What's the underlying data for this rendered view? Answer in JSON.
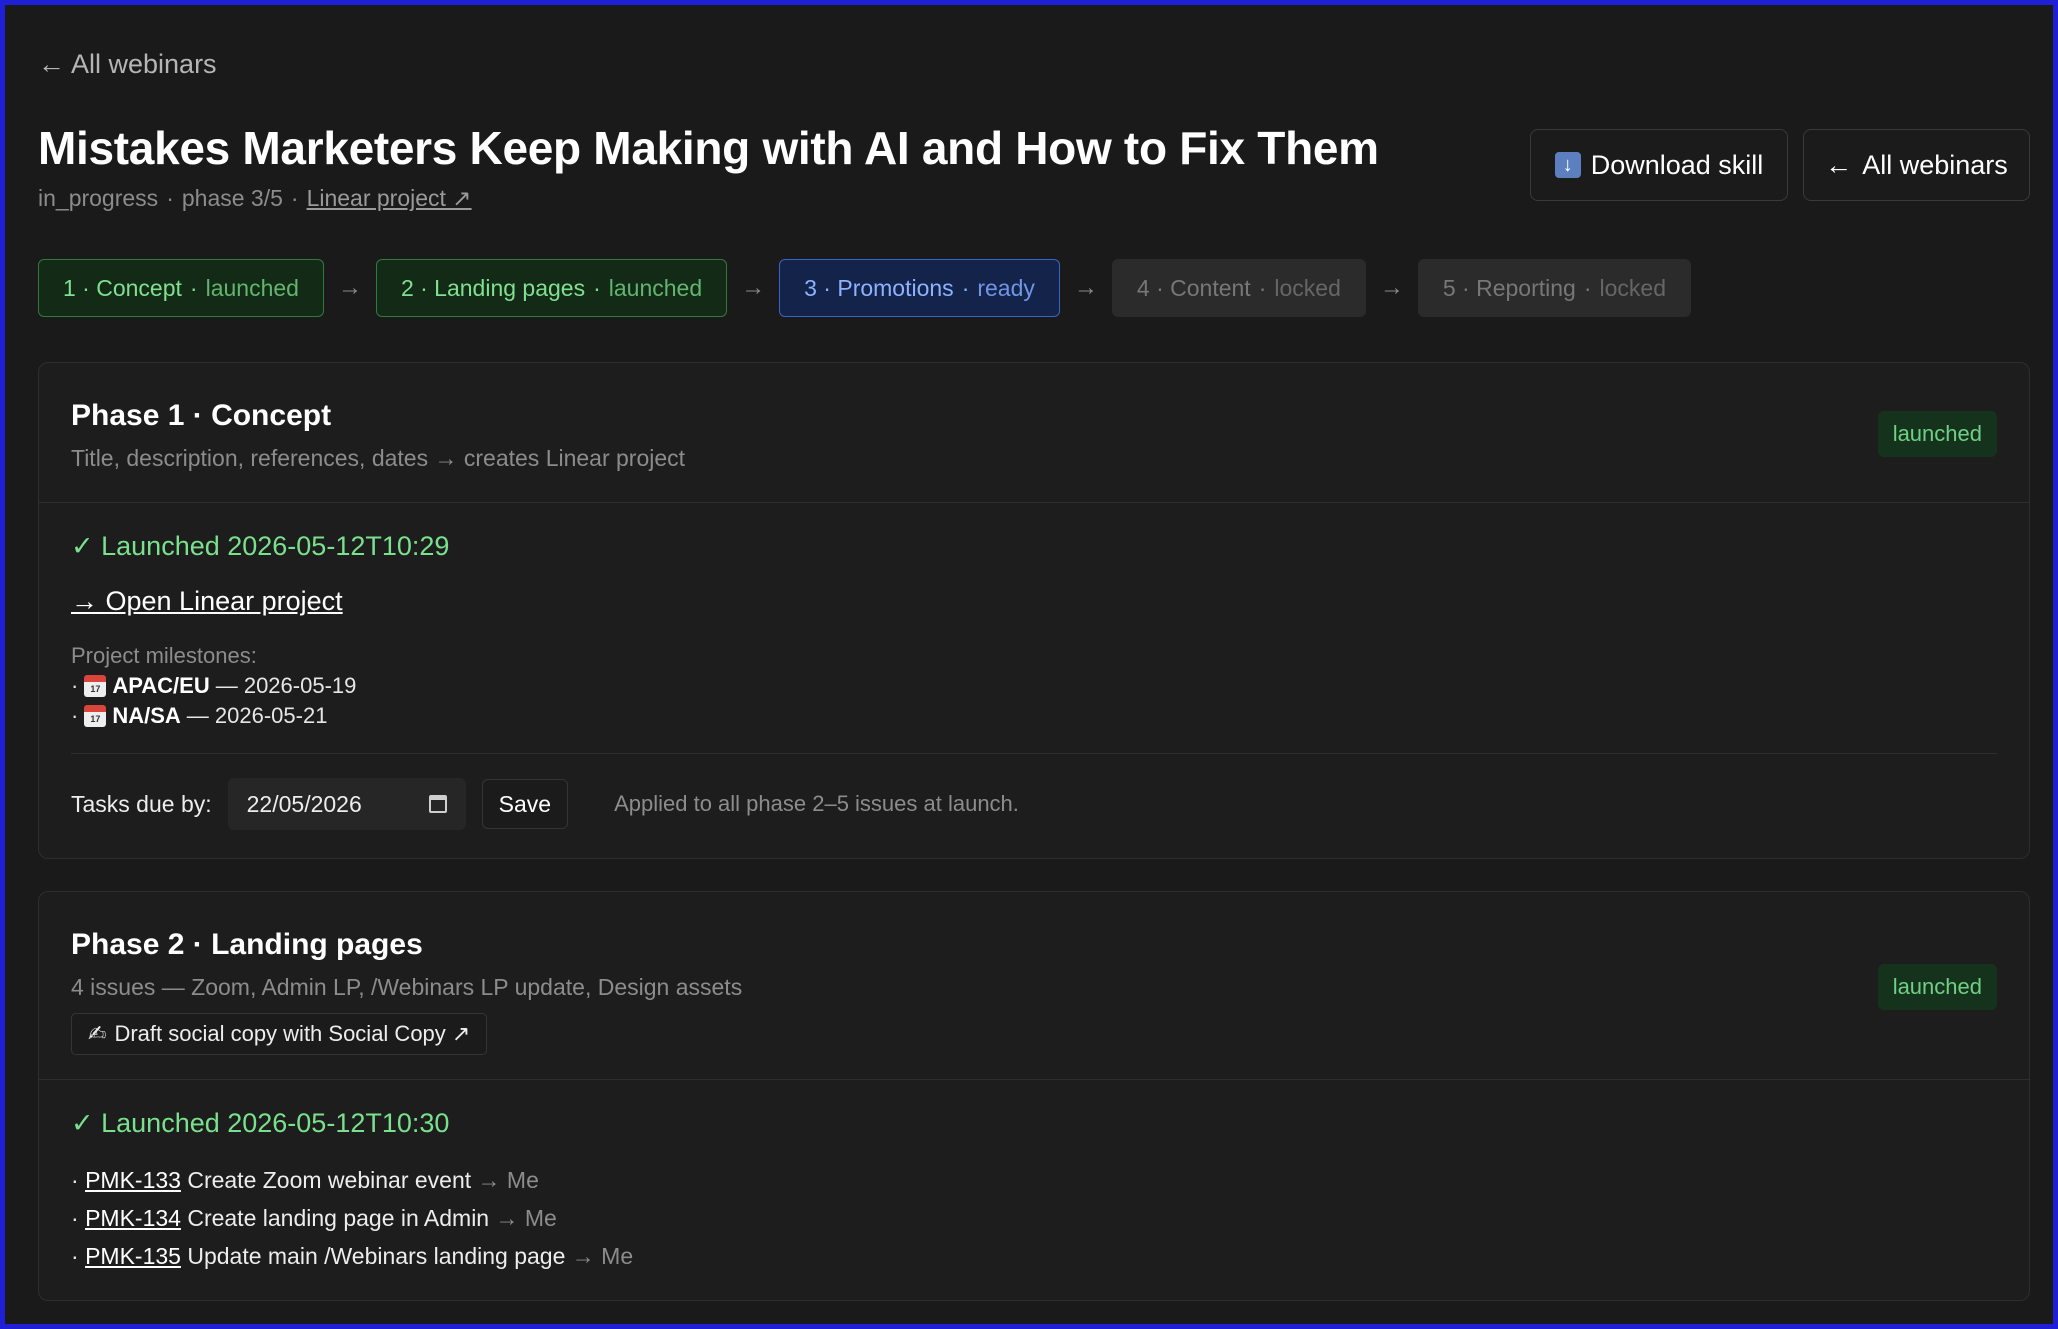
{
  "nav": {
    "back_label": "All webinars"
  },
  "header": {
    "title": "Mistakes Marketers Keep Making with AI and How to Fix Them",
    "status": "in_progress",
    "phase": "phase 3/5",
    "linear_link": "Linear project ↗",
    "download_label": "Download skill",
    "all_webinars_label": "All webinars"
  },
  "steps": [
    {
      "label": "1 · Concept",
      "state": "launched"
    },
    {
      "label": "2 · Landing pages",
      "state": "launched"
    },
    {
      "label": "3 · Promotions",
      "state": "ready"
    },
    {
      "label": "4 · Content",
      "state": "locked"
    },
    {
      "label": "5 · Reporting",
      "state": "locked"
    }
  ],
  "phase1": {
    "title": "Phase 1 · Concept",
    "subtitle": "Title, description, references, dates → creates Linear project",
    "badge": "launched",
    "launched_text": "✓ Launched 2026-05-12T10:29",
    "open_link": "→ Open Linear project",
    "milestones_label": "Project milestones:",
    "milestones": [
      {
        "name": "APAC/EU",
        "date": "— 2026-05-19"
      },
      {
        "name": "NA/SA",
        "date": "— 2026-05-21"
      }
    ],
    "tasks_label": "Tasks due by:",
    "tasks_date": "22/05/2026",
    "save_label": "Save",
    "hint": "Applied to all phase 2–5 issues at launch."
  },
  "phase2": {
    "title": "Phase 2 · Landing pages",
    "subtitle": "4 issues — Zoom, Admin LP, /Webinars LP update, Design assets",
    "badge": "launched",
    "social_btn": "Draft social copy with Social Copy ↗",
    "launched_text": "✓ Launched 2026-05-12T10:30",
    "issues": [
      {
        "key": "PMK-133",
        "text": "Create Zoom webinar event",
        "assignee": "→ Me"
      },
      {
        "key": "PMK-134",
        "text": "Create landing page in Admin",
        "assignee": "→ Me"
      },
      {
        "key": "PMK-135",
        "text": "Update main /Webinars landing page",
        "assignee": "→ Me"
      }
    ]
  }
}
